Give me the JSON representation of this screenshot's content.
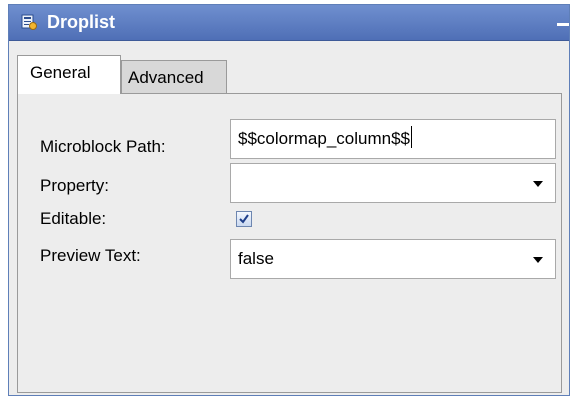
{
  "window": {
    "title": "Droplist"
  },
  "tabs": [
    {
      "label": "General",
      "selected": true
    },
    {
      "label": "Advanced",
      "selected": false
    }
  ],
  "form": {
    "microblock_path": {
      "label": "Microblock Path:",
      "value": "$$colormap_column$$"
    },
    "property": {
      "label": "Property:",
      "value": ""
    },
    "editable": {
      "label": "Editable:",
      "checked": true
    },
    "preview_text": {
      "label": "Preview Text:",
      "value": "false"
    }
  },
  "colors": {
    "titlebar": "#5a7bc0",
    "panel_background": "#ededed",
    "checkbox_check": "#1f3f8a"
  },
  "icons": {
    "title": "form-properties-icon",
    "minimize": "minimize-icon",
    "dropdown": "chevron-down-icon",
    "check": "checkmark-icon"
  }
}
